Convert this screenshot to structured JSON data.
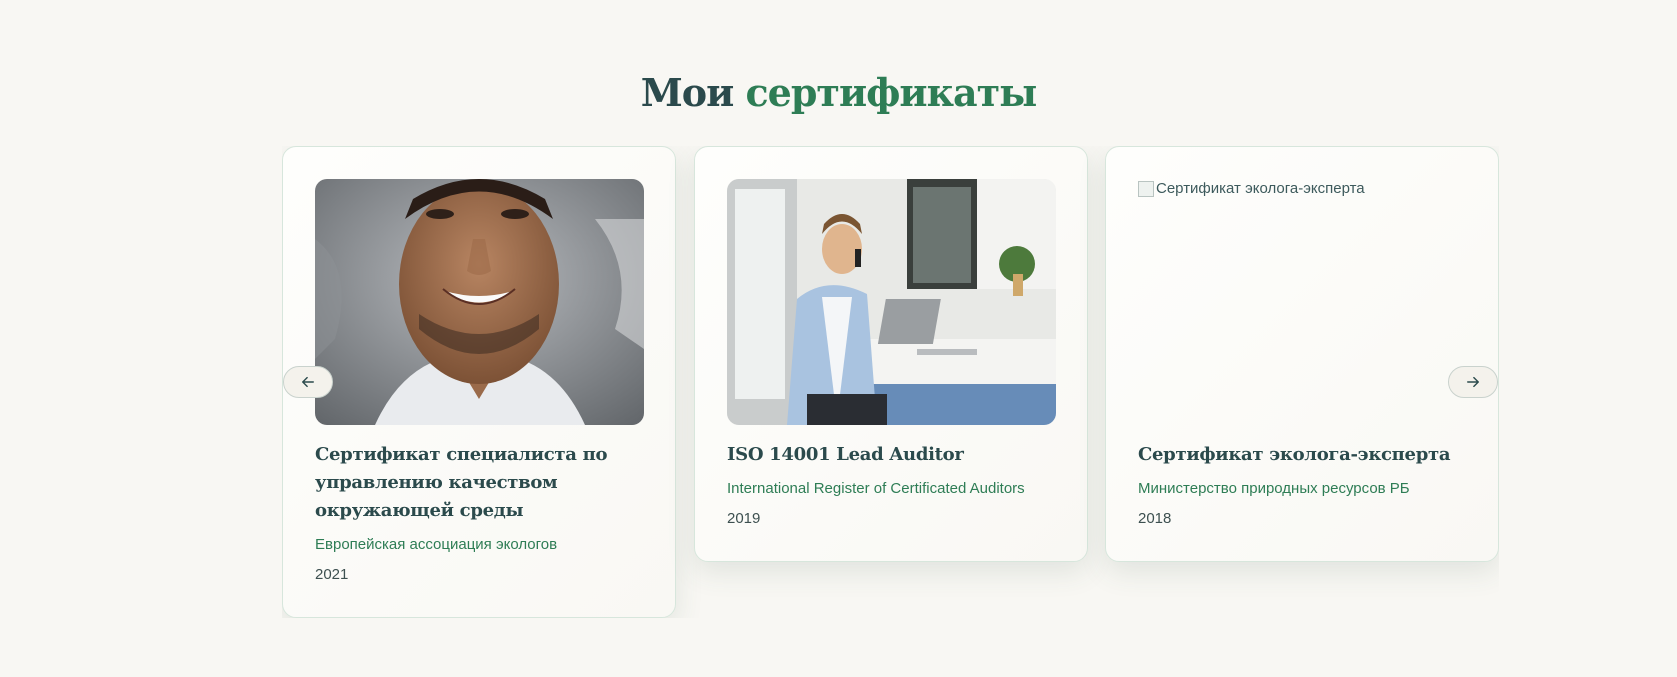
{
  "section": {
    "title_main": "Мои",
    "title_accent": "сертификаты"
  },
  "certificates": [
    {
      "title": "Сертификат специалиста по управлению качеством окружающей среды",
      "issuer": "Европейская ассоциация экологов",
      "year": "2021",
      "image": "portrait-photo"
    },
    {
      "title": "ISO 14001 Lead Auditor",
      "issuer": "International Register of Certificated Auditors",
      "year": "2019",
      "image": "office-photo"
    },
    {
      "title": "Сертификат эколога-эксперта",
      "issuer": "Министерство природных ресурсов РБ",
      "year": "2018",
      "image_alt": "Сертификат эколога-эксперта"
    }
  ],
  "nav": {
    "prev_icon": "arrow-left-icon",
    "next_icon": "arrow-right-icon"
  },
  "colors": {
    "heading": "#2b4a4c",
    "accent": "#2e7d55",
    "background": "#f8f7f3"
  }
}
